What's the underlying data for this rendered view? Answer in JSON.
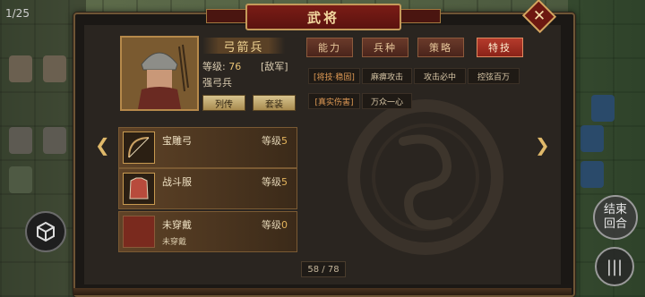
{
  "title": "武将",
  "counter": "1/25",
  "general": {
    "name": "弓箭兵",
    "level_label": "等级:",
    "level_value": "76",
    "faction": "[敌军]",
    "unit_type": "强弓兵",
    "btn_biography": "列传",
    "btn_outfit": "套装"
  },
  "equipment": [
    {
      "name": "宝雕弓",
      "level_label": "等级",
      "level": "5",
      "sub": ""
    },
    {
      "name": "战斗服",
      "level_label": "等级",
      "level": "5",
      "sub": ""
    },
    {
      "name": "未穿戴",
      "level_label": "等级",
      "level": "0",
      "sub": "未穿戴"
    }
  ],
  "tabs": [
    "能力",
    "兵种",
    "策略",
    "特技"
  ],
  "active_tab": "特技",
  "skills": {
    "row1_tag": "[将技·稳固]",
    "row1": [
      "麻痹攻击",
      "攻击必中",
      "控弦百万"
    ],
    "row2_tag": "[真实伤害]",
    "row2": [
      "万众一心"
    ]
  },
  "page_indicator": "58 / 78",
  "end_turn": "结束\n回合",
  "end_turn_top": "结束",
  "end_turn_bottom": "回合",
  "colors": {
    "title_red": "#7a1c16",
    "gold": "#c59a5a",
    "active_tab": "#b53b2c"
  },
  "icons": {
    "close": "close-icon",
    "prev": "chevron-left-icon",
    "next": "chevron-right-icon",
    "cube": "cube-icon",
    "menu": "menu-icon"
  }
}
